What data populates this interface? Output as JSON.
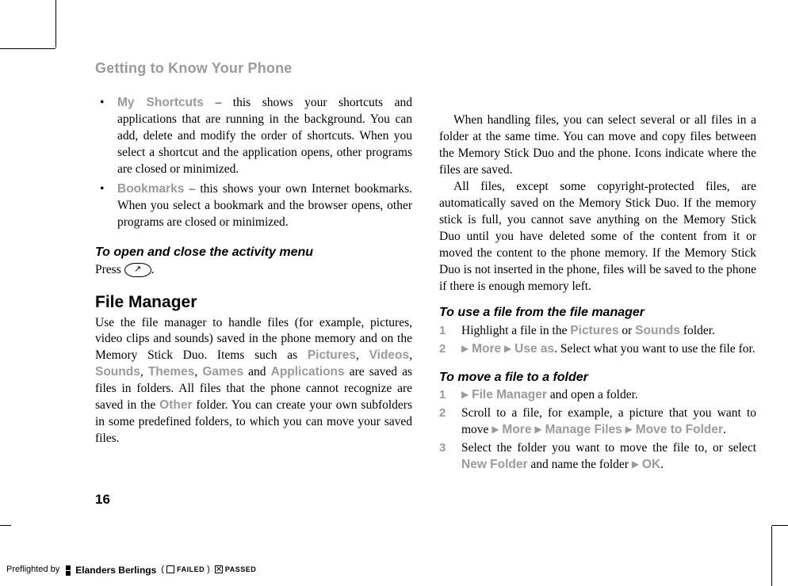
{
  "header": "Getting to Know Your Phone",
  "page_number": "16",
  "col1": {
    "bullets": [
      {
        "label": "My Shortcuts",
        "dash": " – ",
        "text": "this shows your shortcuts and applications that are running in the background. You can add, delete and modify the order of shortcuts. When you select a shortcut and the application opens, other programs are closed or minimized."
      },
      {
        "label": "Bookmarks",
        "dash": " – ",
        "text": "this shows your own Internet bookmarks. When you select a bookmark and the browser opens, other programs are closed or minimized."
      }
    ],
    "sub1": "To open and close the activity menu",
    "press_prefix": "Press ",
    "press_suffix": ".",
    "h1": "File Manager",
    "fm_body_a": "Use the file manager to handle files (for example, pictures, video clips and sounds) saved in the phone memory and on the Memory Stick Duo. Items such as ",
    "fm_pictures": "Pictures",
    "fm_videos": "Videos",
    "fm_sounds": "Sounds",
    "fm_themes": "Themes",
    "fm_games": "Games",
    "fm_apps": "Applications",
    "fm_body_b": " are saved as files in folders. All files that the phone cannot recognize are saved in the ",
    "fm_other": "Other",
    "fm_body_c": " folder. You can create your own subfolders in some predefined folders, to which you can move your saved files."
  },
  "col2": {
    "p1": "When handling files, you can select several or all files in a folder at the same time. You can move and copy files between the Memory Stick Duo and the phone. Icons indicate where the files are saved.",
    "p2": "All files, except some copyright-protected files, are automatically saved on the Memory Stick Duo. If the memory stick is full, you cannot save anything on the Memory Stick Duo until you have deleted some of the content from it or moved the content to the phone memory. If the Memory Stick Duo is not inserted in the phone, files will be saved to the phone if there is enough memory left.",
    "sub_use": "To use a file from the file manager",
    "use_steps": {
      "s1_a": "Highlight a file in the ",
      "s1_pictures": "Pictures",
      "s1_or": " or ",
      "s1_sounds": "Sounds",
      "s1_b": " folder.",
      "s2_more": "More",
      "s2_useas": "Use as",
      "s2_rest": ". Select what you want to use the file for."
    },
    "sub_move": "To move a file to a folder",
    "move_steps": {
      "s1_fm": "File Manager",
      "s1_rest": " and open a folder.",
      "s2_a": "Scroll to a file, for example, a picture that you want to move ",
      "s2_more": "More",
      "s2_manage": "Manage Files",
      "s2_moveto": "Move to Folder",
      "s3_a": "Select the folder you want to move the file to, or select ",
      "s3_newfolder": "New Folder",
      "s3_b": " and name the folder ",
      "s3_ok": "OK"
    }
  },
  "preflight": {
    "by": "Preflighted by",
    "brand": "Elanders Berlings",
    "failed": "FAILED",
    "passed": "PASSED"
  }
}
